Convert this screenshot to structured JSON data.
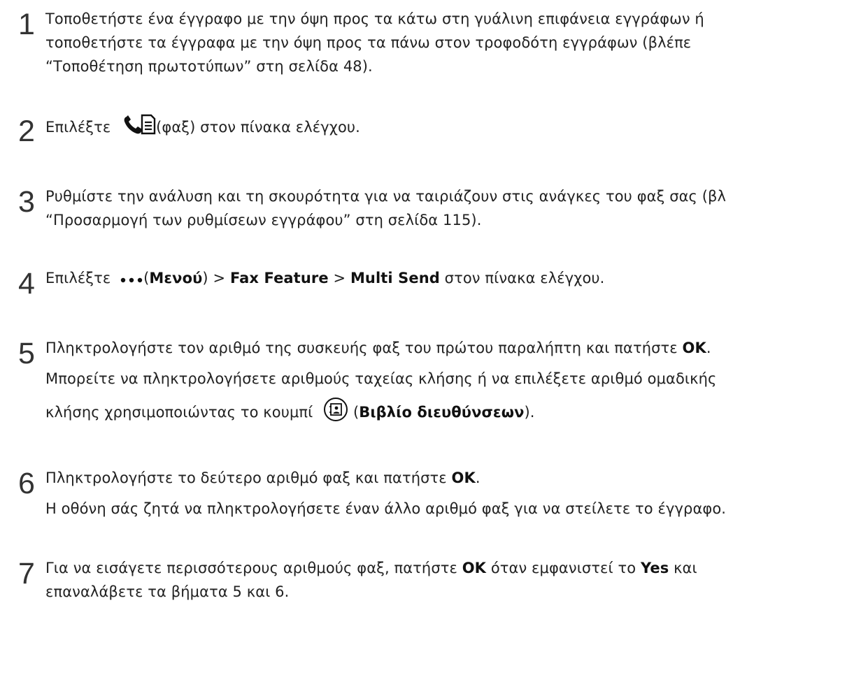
{
  "steps": [
    {
      "number": "1",
      "line1": "Τοποθετήστε ένα έγγραφο με την όψη προς τα κάτω στη γυάλινη επιφάνεια εγγράφων ή",
      "line2": "τοποθετήστε τα έγγραφα με την όψη προς τα πάνω στον τροφοδότη εγγράφων (βλέπε",
      "line3": "“Τοποθέτηση πρωτοτύπων” στη σελίδα 48)."
    },
    {
      "number": "2",
      "before": "Επιλέξτε",
      "icon": "fax-icon",
      "after": "(φαξ) στον πίνακα ελέγχου."
    },
    {
      "number": "3",
      "line1": "Ρυθμίστε την ανάλυση και τη σκουρότητα για να ταιριάζουν στις ανάγκες του φαξ σας (βλ",
      "line2": "“Προσαρμογή των ρυθμίσεων εγγράφου” στη σελίδα 115)."
    },
    {
      "number": "4",
      "before": "Επιλέξτε",
      "icon": "more-dots-icon",
      "menu_label": "Μενού",
      "sep": " > ",
      "feature": "Fax Feature",
      "multi": "Multi Send",
      "after": " στον πίνακα ελέγχου."
    },
    {
      "number": "5",
      "line1_text": "Πληκτρολογήστε τον αριθμό της συσκευής φαξ του πρώτου παραλήπτη και πατήστε ",
      "ok": "OK",
      "line2": "Μπορείτε να πληκτρολογήσετε αριθμούς ταχείας κλήσης ή να επιλέξετε αριθμό ομαδικής",
      "line3_before": "κλήσης χρησιμοποιώντας το κουμπί",
      "icon": "address-book-icon",
      "addr": "Βιβλίο διευθύνσεων"
    },
    {
      "number": "6",
      "line1_text": "Πληκτρολογήστε το δεύτερο αριθμό φαξ και πατήστε ",
      "ok": "OK",
      "line2": "Η οθόνη σάς ζητά να πληκτρολογήσετε έναν άλλο αριθμό φαξ για να στείλετε το έγγραφο."
    },
    {
      "number": "7",
      "line1_before": "Για να εισάγετε περισσότερους αριθμούς φαξ, πατήστε ",
      "ok": "OK",
      "line1_mid": " όταν εμφανιστεί το ",
      "yes": "Yes",
      "line1_after": " και",
      "line2": "επαναλάβετε τα βήματα 5 και 6."
    }
  ]
}
